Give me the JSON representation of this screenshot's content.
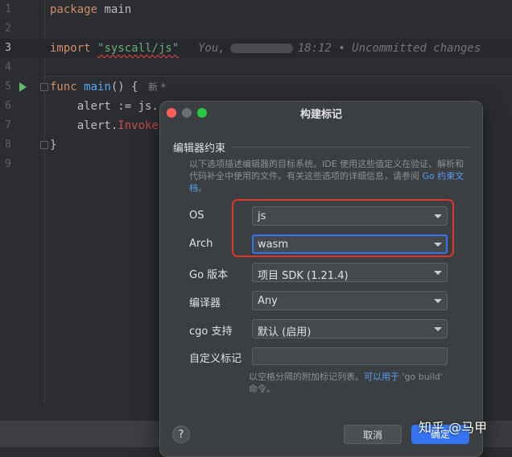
{
  "editor": {
    "line_numbers": [
      "1",
      "2",
      "3",
      "4",
      "5",
      "6",
      "7",
      "8",
      "9"
    ],
    "line1": {
      "kw": "package",
      "rest": " main"
    },
    "line3": {
      "kw": "import",
      "sp": " ",
      "str": "\"syscall/js\""
    },
    "blame": {
      "author": "You,",
      "time": "18:12 • Uncommitted changes"
    },
    "line5": {
      "kw": "func",
      "sp": " ",
      "fn": "main",
      "rest": "() {"
    },
    "line5_lens": "新 *",
    "line6": "    alert := js.",
    "line7": {
      "pre": "    alert.",
      "red": "Invoke"
    },
    "line8": "}"
  },
  "dialog": {
    "title": "构建标记",
    "section_title": "编辑器约束",
    "desc_text": "以下选项描述编辑器的目标系统。IDE 使用这些值定义在验证、解析和代码补全中使用的文件。有关这些选项的详细信息，请参阅 ",
    "desc_link": "Go 约束文档",
    "desc_end": "。",
    "fields": {
      "os": {
        "label": "OS",
        "value": "js"
      },
      "arch": {
        "label": "Arch",
        "value": "wasm"
      },
      "go_version": {
        "label": "Go 版本",
        "value": "项目 SDK (1.21.4)"
      },
      "compiler": {
        "label": "编译器",
        "value": "Any"
      },
      "cgo": {
        "label": "cgo 支持",
        "value": "默认 (启用)"
      },
      "custom_tags": {
        "label": "自定义标记",
        "value": ""
      }
    },
    "hint_text": "以空格分隔的附加标记列表。",
    "hint_link": "可以用于",
    "hint_code": " 'go build' ",
    "hint_end": "命令。",
    "help_label": "?",
    "cancel_label": "取消",
    "ok_label": "确定"
  },
  "watermark": "知乎 @马甲",
  "colors": {
    "accent": "#3574f0",
    "highlight": "#e0352b",
    "keyword": "#cf8e6d",
    "string": "#6aab73",
    "function": "#56a8f5"
  }
}
